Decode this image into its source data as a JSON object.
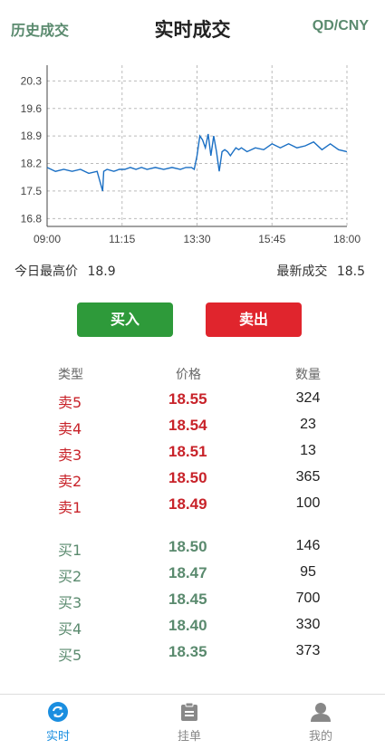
{
  "header": {
    "history_link": "历史成交",
    "title": "实时成交",
    "pair": "QD/CNY"
  },
  "chart_data": {
    "type": "line",
    "x_ticks": [
      "09:00",
      "11:15",
      "13:30",
      "15:45",
      "18:00"
    ],
    "y_ticks": [
      20.3,
      19.6,
      18.9,
      18.2,
      17.5,
      16.8
    ],
    "ylim": [
      16.6,
      20.7
    ],
    "xlim": [
      "09:00",
      "18:00"
    ],
    "grid": true,
    "series": [
      {
        "color": "#1a6fc4",
        "x": [
          "09:00",
          "09:15",
          "09:30",
          "09:45",
          "10:00",
          "10:15",
          "10:30",
          "10:40",
          "10:42",
          "10:48",
          "11:00",
          "11:10",
          "11:20",
          "11:30",
          "11:40",
          "11:50",
          "12:00",
          "12:15",
          "12:30",
          "12:45",
          "13:00",
          "13:10",
          "13:20",
          "13:25",
          "13:30",
          "13:35",
          "13:40",
          "13:45",
          "13:50",
          "13:55",
          "14:00",
          "14:05",
          "14:10",
          "14:15",
          "14:20",
          "14:25",
          "14:30",
          "14:35",
          "14:40",
          "14:45",
          "14:50",
          "15:00",
          "15:15",
          "15:30",
          "15:45",
          "16:00",
          "16:15",
          "16:30",
          "16:45",
          "17:00",
          "17:15",
          "17:30",
          "17:45",
          "18:00"
        ],
        "y": [
          18.1,
          18.0,
          18.05,
          18.0,
          18.05,
          17.95,
          18.0,
          17.5,
          18.0,
          18.05,
          18.0,
          18.05,
          18.05,
          18.1,
          18.05,
          18.1,
          18.05,
          18.1,
          18.05,
          18.1,
          18.05,
          18.1,
          18.1,
          18.05,
          18.4,
          18.9,
          18.8,
          18.6,
          18.95,
          18.4,
          18.9,
          18.5,
          18.0,
          18.5,
          18.55,
          18.5,
          18.4,
          18.5,
          18.6,
          18.55,
          18.6,
          18.5,
          18.6,
          18.55,
          18.7,
          18.6,
          18.7,
          18.6,
          18.65,
          18.75,
          18.55,
          18.7,
          18.55,
          18.5
        ]
      }
    ]
  },
  "stats": {
    "high_label": "今日最高价",
    "high_value": "18.9",
    "last_label": "最新成交",
    "last_value": "18.5"
  },
  "actions": {
    "buy": "买入",
    "sell": "卖出"
  },
  "orderbook": {
    "headers": {
      "type": "类型",
      "price": "价格",
      "qty": "数量"
    },
    "asks": [
      {
        "type": "卖5",
        "price": "18.55",
        "qty": "324"
      },
      {
        "type": "卖4",
        "price": "18.54",
        "qty": "23"
      },
      {
        "type": "卖3",
        "price": "18.51",
        "qty": "13"
      },
      {
        "type": "卖2",
        "price": "18.50",
        "qty": "365"
      },
      {
        "type": "卖1",
        "price": "18.49",
        "qty": "100"
      }
    ],
    "bids": [
      {
        "type": "买1",
        "price": "18.50",
        "qty": "146"
      },
      {
        "type": "买2",
        "price": "18.47",
        "qty": "95"
      },
      {
        "type": "买3",
        "price": "18.45",
        "qty": "700"
      },
      {
        "type": "买4",
        "price": "18.40",
        "qty": "330"
      },
      {
        "type": "买5",
        "price": "18.35",
        "qty": "373"
      }
    ]
  },
  "tabbar": {
    "items": [
      {
        "label": "实时",
        "active": true,
        "icon": "refresh-icon"
      },
      {
        "label": "挂单",
        "active": false,
        "icon": "clipboard-icon"
      },
      {
        "label": "我的",
        "active": false,
        "icon": "user-icon"
      }
    ],
    "active_color": "#1a8ee0",
    "inactive_color": "#888888"
  }
}
